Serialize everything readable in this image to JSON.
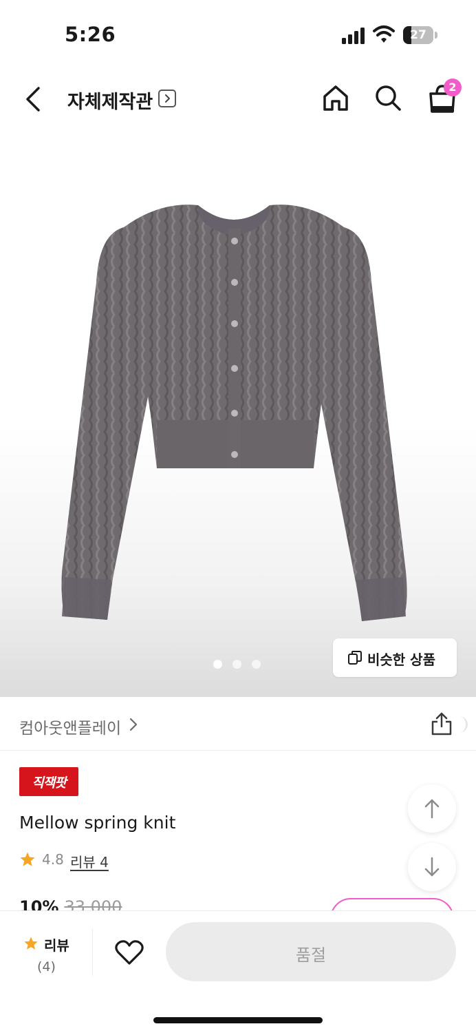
{
  "status_bar": {
    "time": "5:26",
    "battery_level": "27",
    "battery_fraction": 0.27,
    "icons": [
      "signal-icon",
      "wifi-icon",
      "battery-icon"
    ]
  },
  "header": {
    "title": "자체제작관",
    "icons": [
      "back-icon",
      "chevron-right-icon",
      "home-icon",
      "search-icon",
      "shopping-bag-icon"
    ],
    "cart_count": "2"
  },
  "gallery": {
    "image_description_icon": "product-photo",
    "page_count": 3,
    "active_page": 1,
    "similar_button_label": "비슷한 상품"
  },
  "brand": {
    "name": "컴아웃앤플레이",
    "icons": [
      "chevron-right-icon",
      "share-icon"
    ]
  },
  "product": {
    "badge_label": "직잭팟",
    "name": "Mellow spring knit",
    "rating": "4.8",
    "review_link": "리뷰 4",
    "discount": "10%",
    "original_price": "33,000"
  },
  "bottom_bar": {
    "review_label": "리뷰",
    "review_count": "(4)",
    "soldout_label": "품절"
  },
  "colors": {
    "accent_pink": "#f25cc8",
    "badge_red": "#d6141b",
    "star_orange": "#f5a623",
    "soldout_bg": "#ebebeb"
  }
}
